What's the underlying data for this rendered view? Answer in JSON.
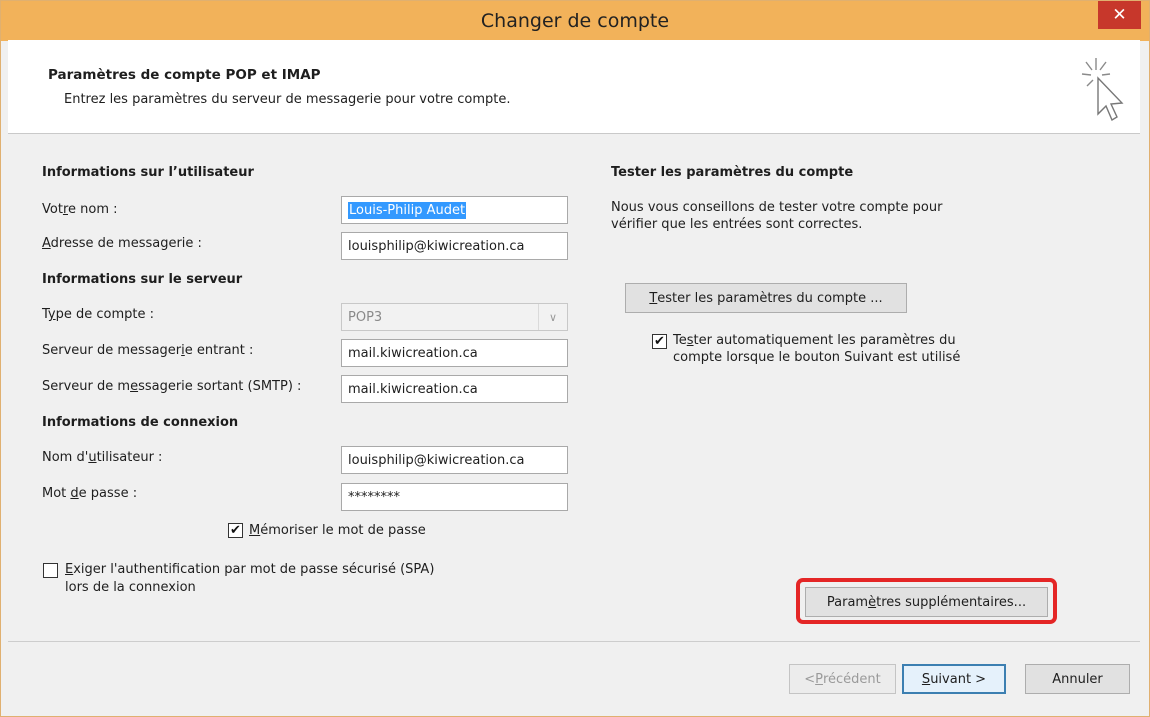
{
  "window": {
    "title": "Changer de compte",
    "close_glyph": "✕"
  },
  "header": {
    "title": "Paramètres de compte POP et IMAP",
    "subtitle": "Entrez les paramètres du serveur de messagerie pour votre compte.",
    "icon": "cursor-sparkle-icon"
  },
  "user_info": {
    "heading": "Informations sur l’utilisateur",
    "name_label_pre": "Vot",
    "name_label_key": "r",
    "name_label_post": "e nom :",
    "name_value": "Louis-Philip Audet",
    "email_label_pre": "",
    "email_label_key": "A",
    "email_label_post": "dresse de messagerie :",
    "email_value": "louisphilip@kiwicreation.ca"
  },
  "server_info": {
    "heading": "Informations sur le serveur",
    "type_label_pre": "T",
    "type_label_key": "y",
    "type_label_post": "pe de compte :",
    "type_value": "POP3",
    "incoming_label_pre": "Serveur de messager",
    "incoming_label_key": "i",
    "incoming_label_post": "e entrant :",
    "incoming_value": "mail.kiwicreation.ca",
    "outgoing_label_pre": "Serveur de m",
    "outgoing_label_key": "e",
    "outgoing_label_post": "ssagerie sortant (SMTP) :",
    "outgoing_value": "mail.kiwicreation.ca"
  },
  "login_info": {
    "heading": "Informations de connexion",
    "user_label_pre": "Nom d'",
    "user_label_key": "u",
    "user_label_post": "tilisateur :",
    "user_value": "louisphilip@kiwicreation.ca",
    "pass_label_pre": "Mot ",
    "pass_label_key": "d",
    "pass_label_post": "e passe :",
    "pass_value": "********",
    "remember_pre": "",
    "remember_key": "M",
    "remember_post": "émoriser le mot de passe",
    "remember_checked": "✔",
    "spa_line1_pre": "",
    "spa_line1_key": "E",
    "spa_line1_post": "xiger l'authentification par mot de passe sécurisé (SPA)",
    "spa_line2": "lors de la connexion"
  },
  "test": {
    "heading": "Tester les paramètres du compte",
    "desc_line1": "Nous vous conseillons de tester votre compte pour",
    "desc_line2": "vérifier que les entrées sont correctes.",
    "button_pre": "",
    "button_key": "T",
    "button_post": "ester les paramètres du compte ...",
    "auto_line1_pre": "Te",
    "auto_line1_key": "s",
    "auto_line1_post": "ter automatiquement les paramètres du",
    "auto_line2": "compte lorsque le bouton Suivant est utilisé",
    "auto_checked": "✔"
  },
  "more_settings": {
    "pre": "Param",
    "key": "è",
    "post": "tres supplémentaires..."
  },
  "footer": {
    "prev_pre": "< ",
    "prev_key": "P",
    "prev_post": "récédent",
    "next_pre": "",
    "next_key": "S",
    "next_post": "uivant >",
    "cancel": "Annuler"
  },
  "colors": {
    "titlebar": "#f2b25a",
    "close": "#c7372b",
    "highlight": "#e42626",
    "selection": "#3399ff"
  }
}
